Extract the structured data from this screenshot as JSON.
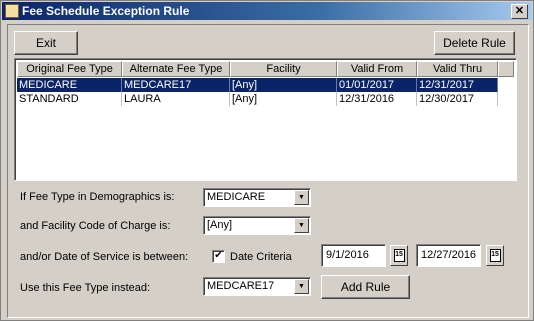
{
  "window": {
    "title": "Fee Schedule Exception Rule",
    "close_glyph": "✕"
  },
  "toolbar": {
    "exit_label": "Exit",
    "delete_label": "Delete Rule"
  },
  "grid": {
    "columns": [
      "Original Fee Type",
      "Alternate Fee Type",
      "Facility",
      "Valid From",
      "Valid Thru"
    ],
    "rows": [
      [
        "MEDICARE",
        "MEDCARE17",
        "[Any]",
        "01/01/2017",
        "12/31/2017"
      ],
      [
        "STANDARD",
        "LAURA",
        "[Any]",
        "12/31/2016",
        "12/30/2017"
      ]
    ]
  },
  "form": {
    "fee_type_label": "If Fee Type in Demographics is:",
    "fee_type_value": "MEDICARE",
    "facility_label": "and Facility Code of Charge is:",
    "facility_value": "[Any]",
    "date_label": "and/or Date of Service is between:",
    "date_criteria_label": "Date Criteria",
    "date_criteria_checked": true,
    "date_from": "9/1/2016",
    "date_to": "12/27/2016",
    "use_fee_label": "Use this Fee Type instead:",
    "use_fee_value": "MEDCARE17",
    "add_rule_label": "Add Rule"
  },
  "icons": {
    "calendar": "calendar-icon",
    "dropdown": "chevron-down-icon",
    "window": "app-icon"
  },
  "colors": {
    "selection": "#0a246a",
    "titlebar": "#0a246a",
    "face": "#d4d0c8"
  }
}
